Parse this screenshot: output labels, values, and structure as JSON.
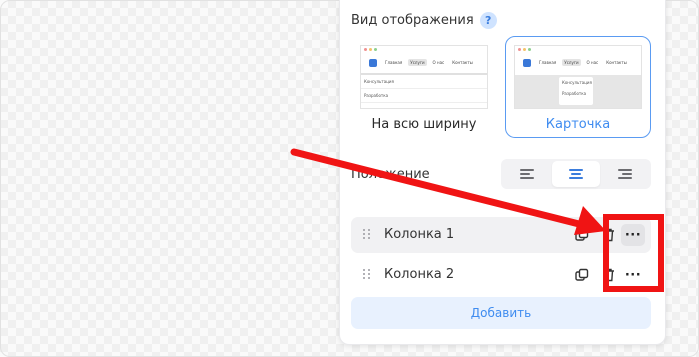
{
  "panel": {
    "section_title": "Вид отображения",
    "help_icon_label": "?",
    "view_options": [
      {
        "label": "На всю ширину",
        "selected": false,
        "thumb_nav": [
          "Главная",
          "Услуги",
          "О нас",
          "Контакты"
        ],
        "thumb_items": [
          "Консультация",
          "Разработка"
        ]
      },
      {
        "label": "Карточка",
        "selected": true,
        "thumb_nav": [
          "Главная",
          "Услуги",
          "О нас",
          "Контакты"
        ],
        "thumb_items": [
          "Консультация",
          "Разработка"
        ]
      }
    ],
    "position_label": "Положение",
    "alignment": {
      "options": [
        "left",
        "center",
        "right"
      ],
      "selected": "center"
    },
    "columns": [
      {
        "name": "Колонка 1",
        "highlighted": true
      },
      {
        "name": "Колонка 2",
        "highlighted": false
      }
    ],
    "add_button_label": "Добавить"
  },
  "colors": {
    "accent": "#3f8cf0",
    "annotation": "#f01414",
    "add_button_bg": "#e8f1fe"
  }
}
